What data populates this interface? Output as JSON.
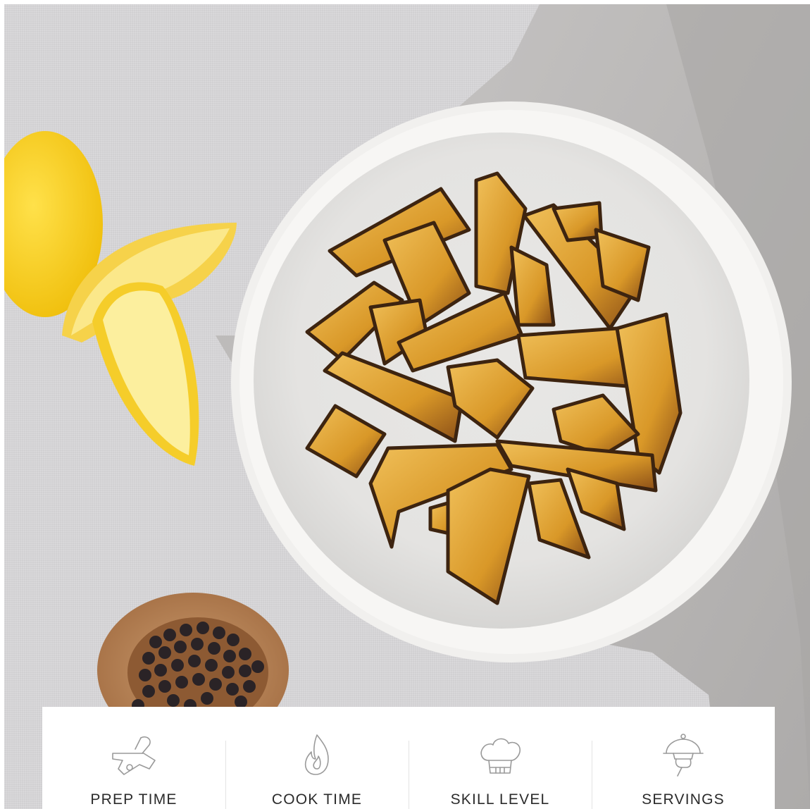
{
  "photo": {
    "subject": "roasted-potato-wedges-bowl",
    "colors": {
      "tablecloth": "#d9d8da",
      "napkin": "#b9b7b6",
      "bowl": "#ececea",
      "lemon": "#f6cd17",
      "potato": "#d79a2b",
      "char": "#4a2d16",
      "pepper_bowl": "#b07a4f",
      "peppercorns": "#2a2326"
    }
  },
  "recipe_info": {
    "items": [
      {
        "icon": "cutting-board-icon",
        "label": "PREP TIME"
      },
      {
        "icon": "flame-icon",
        "label": "COOK TIME"
      },
      {
        "icon": "chef-hat-icon",
        "label": "SKILL LEVEL"
      },
      {
        "icon": "serving-cloche-icon",
        "label": "SERVINGS"
      }
    ],
    "icon_color": "#9a9a9a",
    "label_color": "#2b2b2b"
  }
}
